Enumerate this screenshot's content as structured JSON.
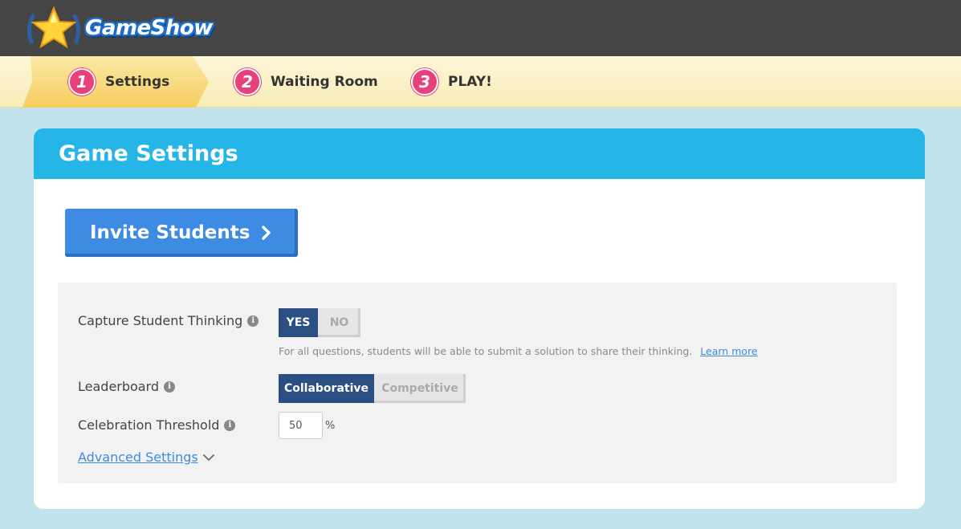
{
  "app": {
    "name": "GameShow"
  },
  "colors": {
    "accent": "#26b5e7",
    "step_badge": "#e8407a",
    "button": "#3d8be3",
    "toggle_on": "#2c4f83"
  },
  "stepper": {
    "steps": [
      {
        "number": "1",
        "label": "Settings",
        "active": true
      },
      {
        "number": "2",
        "label": "Waiting Room",
        "active": false
      },
      {
        "number": "3",
        "label": "PLAY!",
        "active": false
      }
    ]
  },
  "card": {
    "title": "Game Settings",
    "invite_label": "Invite Students"
  },
  "settings": {
    "capture": {
      "label": "Capture Student Thinking",
      "yes": "YES",
      "no": "NO",
      "selected": "YES",
      "help": "For all questions, students will be able to submit a solution to share their thinking.",
      "learn_more": "Learn more"
    },
    "leaderboard": {
      "label": "Leaderboard",
      "option_a": "Collaborative",
      "option_b": "Competitive",
      "selected": "Collaborative"
    },
    "threshold": {
      "label": "Celebration Threshold",
      "value": "50",
      "unit": "%"
    },
    "advanced_label": "Advanced Settings"
  }
}
